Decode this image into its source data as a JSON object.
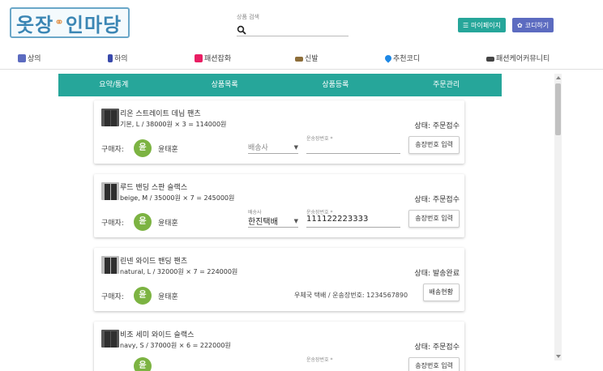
{
  "logo": {
    "part1": "옷장",
    "part2": "인",
    "part3": "마당"
  },
  "search": {
    "label": "상품 검색",
    "value": ""
  },
  "header_buttons": {
    "mypage": "마이페이지",
    "codi": "코디하기"
  },
  "nav": [
    {
      "label": "상의",
      "icon": "shirt-icon",
      "color": "#5c6bc0"
    },
    {
      "label": "하의",
      "icon": "pants-icon",
      "color": "#3949ab"
    },
    {
      "label": "패션잡화",
      "icon": "bag-icon",
      "color": "#e91e63"
    },
    {
      "label": "신발",
      "icon": "shoe-icon",
      "color": "#8d6e3a"
    },
    {
      "label": "추천코디",
      "icon": "heart-icon",
      "color": "#1e88e5"
    },
    {
      "label": "패션케어커뮤니티",
      "icon": "glasses-icon",
      "color": "#444444"
    }
  ],
  "tabs": [
    "요약/통계",
    "상품목록",
    "상품등록",
    "주문관리"
  ],
  "buyer_label": "구매자:",
  "orders": [
    {
      "name": "리온 스트레이트 데님 팬츠",
      "option": "기본, L  /  38000원 × 3  =  114000원",
      "status": "상태: 주문접수",
      "buyer_initial": "윤",
      "buyer_name": "윤태훈",
      "carrier_label": "",
      "carrier": "배송사",
      "tracking_label": "운송장번호 *",
      "tracking": "",
      "button": "송장번호 입력"
    },
    {
      "name": "루드 밴딩 스판 슬랙스",
      "option": "beige, M  /  35000원 × 7  =  245000원",
      "status": "상태: 주문접수",
      "buyer_initial": "윤",
      "buyer_name": "윤태훈",
      "carrier_label": "배송사",
      "carrier": "한진택배",
      "tracking_label": "운송장번호 *",
      "tracking": "111122223333",
      "button": "송장번호 입력"
    },
    {
      "name": "린넨 와이드 밴딩 팬츠",
      "option": "natural, L  /  32000원 × 7  =  224000원",
      "status": "상태: 발송완료",
      "buyer_initial": "윤",
      "buyer_name": "윤태훈",
      "ship_info": "우체국 택배 / 운송장번호: 1234567890",
      "button": "배송현황"
    },
    {
      "name": "비조 세미 와이드 슬랙스",
      "option": "navy, S  /  37000원 × 6  =  222000원",
      "status": "상태: 주문접수",
      "buyer_initial": "윤",
      "buyer_name": "윤태훈",
      "tracking_label": "운송장번호 *",
      "button": "송장번호 입력"
    }
  ],
  "colors": {
    "primary": "#26a69a",
    "accent": "#5c6bc0",
    "avatar": "#7cb342"
  }
}
